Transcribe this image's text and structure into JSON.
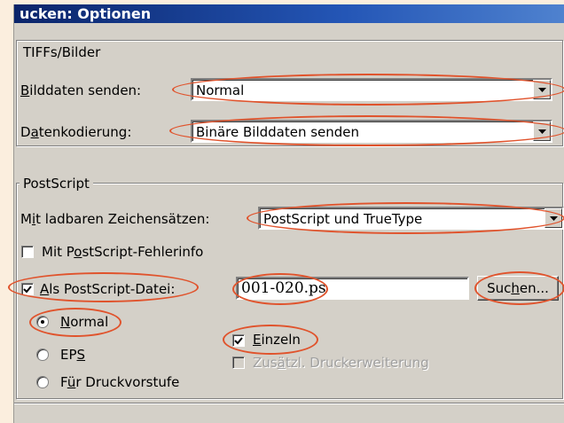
{
  "window": {
    "title": "ucken: Optionen"
  },
  "tiffs": {
    "group_label": "TIFFs/Bilder",
    "bilddaten": {
      "label_pre": "",
      "label_u": "B",
      "label_post": "ilddaten senden:",
      "value": "Normal"
    },
    "kodierung": {
      "label_pre": "D",
      "label_u": "a",
      "label_post": "tenkodierung:",
      "value": "Binäre Bilddaten senden"
    }
  },
  "postscript": {
    "group_label": "PostScript",
    "zeichensaetze": {
      "label_pre": "M",
      "label_u": "i",
      "label_post": "t ladbaren Zeichensätzen:",
      "value": "PostScript und TrueType"
    },
    "fehlerinfo": {
      "label_pre": "Mit P",
      "label_u": "o",
      "label_post": "stScript-Fehlerinfo",
      "checked": false
    },
    "als_datei": {
      "label_pre": "",
      "label_u": "A",
      "label_post": "ls PostScript-Datei:",
      "checked": true,
      "filename": "001-020.ps"
    },
    "suchen": {
      "label_pre": "Suc",
      "label_u": "h",
      "label_post": "en..."
    },
    "radios": [
      {
        "label_pre": "",
        "label_u": "N",
        "label_post": "ormal",
        "selected": true
      },
      {
        "label_pre": "EP",
        "label_u": "S",
        "label_post": "",
        "selected": false
      },
      {
        "label_pre": "F",
        "label_u": "ü",
        "label_post": "r Druckvorstufe",
        "selected": false
      }
    ],
    "einzeln": {
      "label_pre": "",
      "label_u": "E",
      "label_post": "inzeln",
      "checked": true
    },
    "zusaetzl": {
      "label_pre": "Zus",
      "label_u": "ä",
      "label_post": "tzl. Druckerweiterung",
      "checked": false,
      "enabled": false
    }
  },
  "colors": {
    "annotation": "#e0532c",
    "dialog_bg": "#d4d0c8",
    "title_bar": "#0a246a"
  }
}
